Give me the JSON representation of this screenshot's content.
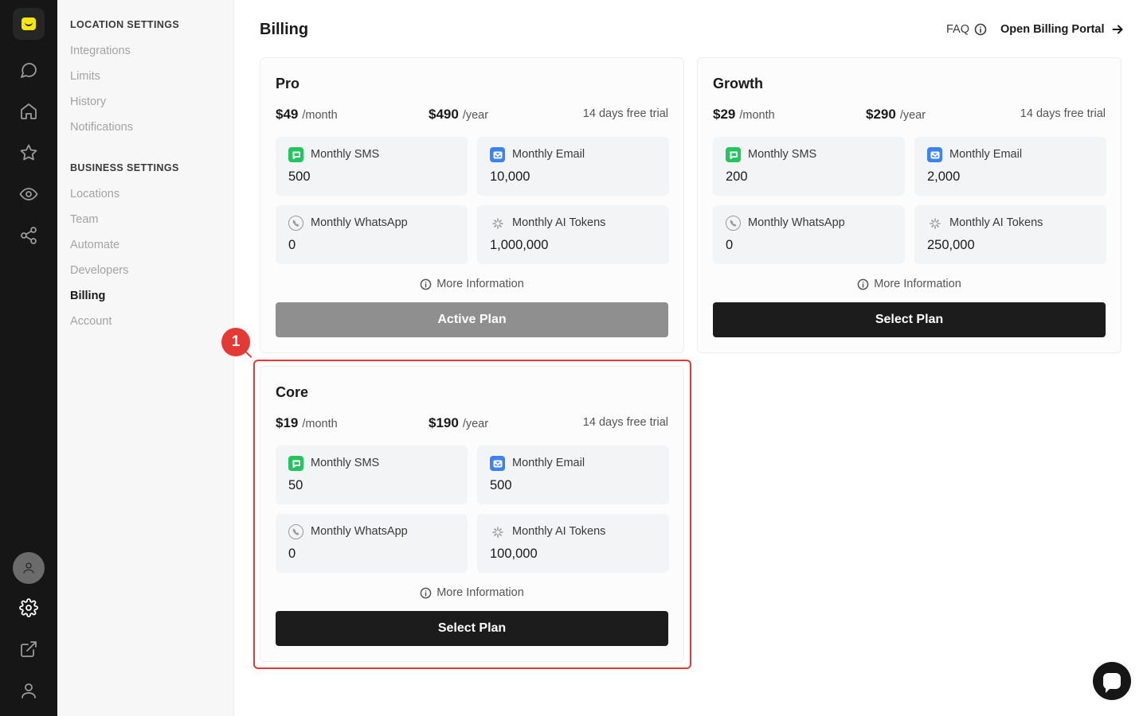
{
  "rail": {
    "icons": [
      "chat-icon",
      "home-icon",
      "star-icon",
      "eye-icon",
      "share-icon",
      "avatar",
      "gear-icon",
      "external-link-icon",
      "user-icon"
    ],
    "logo_color": "#f5e60f"
  },
  "subnav": {
    "location_title": "LOCATION SETTINGS",
    "location_items": [
      "Integrations",
      "Limits",
      "History",
      "Notifications"
    ],
    "business_title": "BUSINESS SETTINGS",
    "business_items": [
      "Locations",
      "Team",
      "Automate",
      "Developers",
      "Billing",
      "Account"
    ],
    "active": "Billing"
  },
  "header": {
    "title": "Billing",
    "faq": "FAQ",
    "portal": "Open Billing Portal"
  },
  "plans": [
    {
      "name": "Pro",
      "monthly": "$49",
      "month_unit": "/month",
      "yearly": "$490",
      "year_unit": "/year",
      "trial": "14 days free trial",
      "features": [
        {
          "label": "Monthly SMS",
          "value": "500",
          "icon": "sms-icon"
        },
        {
          "label": "Monthly Email",
          "value": "10,000",
          "icon": "mail-icon"
        },
        {
          "label": "Monthly WhatsApp",
          "value": "0",
          "icon": "whatsapp-icon"
        },
        {
          "label": "Monthly AI Tokens",
          "value": "1,000,000",
          "icon": "sparkle-icon"
        }
      ],
      "more": "More Information",
      "button": "Active Plan"
    },
    {
      "name": "Growth",
      "monthly": "$29",
      "month_unit": "/month",
      "yearly": "$290",
      "year_unit": "/year",
      "trial": "14 days free trial",
      "features": [
        {
          "label": "Monthly SMS",
          "value": "200",
          "icon": "sms-icon"
        },
        {
          "label": "Monthly Email",
          "value": "2,000",
          "icon": "mail-icon"
        },
        {
          "label": "Monthly WhatsApp",
          "value": "0",
          "icon": "whatsapp-icon"
        },
        {
          "label": "Monthly AI Tokens",
          "value": "250,000",
          "icon": "sparkle-icon"
        }
      ],
      "more": "More Information",
      "button": "Select Plan"
    },
    {
      "name": "Core",
      "monthly": "$19",
      "month_unit": "/month",
      "yearly": "$190",
      "year_unit": "/year",
      "trial": "14 days free trial",
      "features": [
        {
          "label": "Monthly SMS",
          "value": "50",
          "icon": "sms-icon"
        },
        {
          "label": "Monthly Email",
          "value": "500",
          "icon": "mail-icon"
        },
        {
          "label": "Monthly WhatsApp",
          "value": "0",
          "icon": "whatsapp-icon"
        },
        {
          "label": "Monthly AI Tokens",
          "value": "100,000",
          "icon": "sparkle-icon"
        }
      ],
      "more": "More Information",
      "button": "Select Plan"
    }
  ],
  "annotation": {
    "label": "1",
    "color": "#e53935"
  }
}
